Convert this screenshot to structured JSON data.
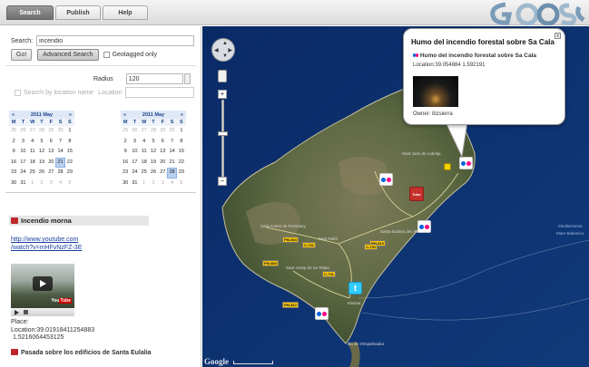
{
  "tabs": [
    {
      "label": "Search",
      "active": true
    },
    {
      "label": "Publish",
      "active": false
    },
    {
      "label": "Help",
      "active": false
    }
  ],
  "search": {
    "label": "Search:",
    "value": "incendio",
    "go_label": "Go!",
    "advanced_label": "Advanced Search",
    "geotagged_label": "Geotagged only",
    "radius_label": "Radius",
    "radius_value": "120",
    "by_location_label": "Search by location name",
    "location_label": "Location",
    "location_value": ""
  },
  "calendars": [
    {
      "month_label": "2011 May",
      "prev": "«",
      "next": "»",
      "dow": [
        "M",
        "T",
        "W",
        "T",
        "F",
        "S",
        "S"
      ],
      "weeks": [
        [
          "25",
          "26",
          "27",
          "28",
          "29",
          "30",
          "1"
        ],
        [
          "2",
          "3",
          "4",
          "5",
          "6",
          "7",
          "8"
        ],
        [
          "9",
          "10",
          "11",
          "12",
          "13",
          "14",
          "15"
        ],
        [
          "16",
          "17",
          "18",
          "19",
          "20",
          "21",
          "22"
        ],
        [
          "23",
          "24",
          "25",
          "26",
          "27",
          "28",
          "29"
        ],
        [
          "30",
          "31",
          "1",
          "2",
          "3",
          "4",
          "5"
        ]
      ],
      "selected": "21"
    },
    {
      "month_label": "2011 May",
      "prev": "«",
      "next": "»",
      "dow": [
        "M",
        "T",
        "W",
        "T",
        "F",
        "S",
        "S"
      ],
      "weeks": [
        [
          "25",
          "26",
          "27",
          "28",
          "29",
          "30",
          "1"
        ],
        [
          "2",
          "3",
          "4",
          "5",
          "6",
          "7",
          "8"
        ],
        [
          "9",
          "10",
          "11",
          "12",
          "13",
          "14",
          "15"
        ],
        [
          "16",
          "17",
          "18",
          "19",
          "20",
          "21",
          "22"
        ],
        [
          "23",
          "24",
          "25",
          "26",
          "27",
          "28",
          "29"
        ],
        [
          "30",
          "31",
          "1",
          "2",
          "3",
          "4",
          "5"
        ]
      ],
      "selected": "28"
    }
  ],
  "result": {
    "title": "Incendio morna",
    "link_line1": "http://www.youtube.com",
    "link_line2": "/watch?v=mHFvNzFZ-3E",
    "place_label": "Place:",
    "location_line1": "Location:39.01918411254883",
    "location_line2": "1.5216064453125",
    "next_title": "Pasada sobre los edificios de Santa Eulalia"
  },
  "popup": {
    "title": "Humo del incendio forestal sobre Sa Cala",
    "subtitle": "Humo del incendio forestal sobre Sa Cala",
    "location": "Location:39.054884 1.592191",
    "owner": "Owner: ibzsierra",
    "close": "x"
  },
  "map": {
    "footer_brand": "Google",
    "labels": [
      "Sant Antoni de Portmany",
      "Sant Josep de sa Talaia",
      "Santa Eulària des Riu",
      "Eivissa",
      "Illa de s'Espalmador",
      "Sant Rafel",
      "Sant Joan de Labritja",
      "Mediterranea",
      "Mare Balearico"
    ],
    "road_tags": [
      "PM-804",
      "PM-810",
      "C-731",
      "PM-803",
      "C-733",
      "PM-812",
      "C-731"
    ]
  },
  "colors": {
    "sea": "#0c2e6b",
    "link": "#1a3fa0",
    "calendar_header": "#15428b"
  }
}
